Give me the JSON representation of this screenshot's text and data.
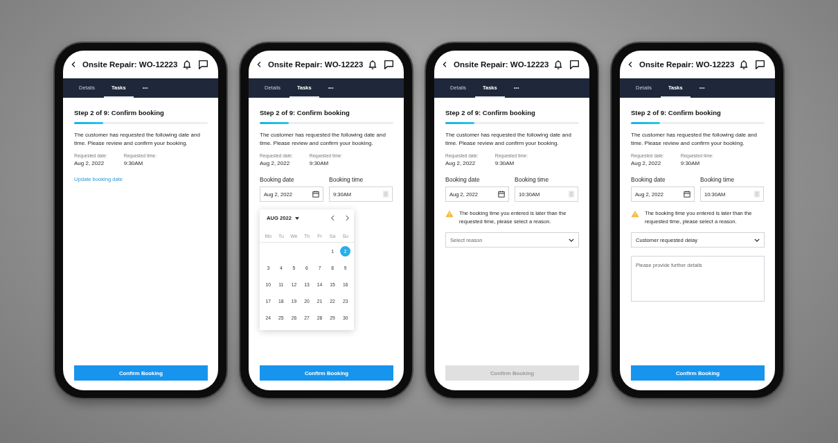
{
  "phones": [
    {
      "title": "Onsite Repair: WO-12223",
      "tabs": [
        {
          "label": "Details",
          "selected": false
        },
        {
          "label": "Tasks",
          "selected": true
        },
        {
          "label": "•••",
          "selected": false
        }
      ],
      "step": "Step 2 of 9: Confirm booking",
      "progress": {
        "level": 0.22
      },
      "description": "The customer has requested the following date and time. Please review and confirm your booking.",
      "requested": [
        {
          "label": "Requested date:",
          "value": "Aug 2, 2022"
        },
        {
          "label": "Requested time:",
          "value": "9:30AM"
        }
      ],
      "link": "Update booking date",
      "confirm": {
        "label": "Confirm Booking",
        "disabled": false
      }
    },
    {
      "title": "Onsite Repair: WO-12223",
      "tabs": [
        {
          "label": "Details",
          "selected": false
        },
        {
          "label": "Tasks",
          "selected": true
        },
        {
          "label": "•••",
          "selected": false
        }
      ],
      "step": "Step 2 of 9: Confirm booking",
      "progress": {
        "level": 0.22
      },
      "description": "The customer has requested the following date and time. Please review and confirm your booking.",
      "requested": [
        {
          "label": "Requested date:",
          "value": "Aug 2, 2022"
        },
        {
          "label": "Requested time:",
          "value": "9:30AM"
        }
      ],
      "booking": {
        "date_label": "Booking date",
        "date_value": "Aug 2, 2022",
        "time_label": "Booking time",
        "time_value": "9:30AM"
      },
      "calendar": {
        "month": "AUG 2022",
        "weekdays": [
          "Mo",
          "Tu",
          "We",
          "Th",
          "Fr",
          "Sa",
          "Su"
        ],
        "weeks": [
          [
            {
              "label": "1",
              "selected": false
            },
            {
              "label": "2",
              "selected": true
            }
          ],
          [
            {
              "label": "3",
              "selected": false
            },
            {
              "label": "4",
              "selected": false
            },
            {
              "label": "5",
              "selected": false
            },
            {
              "label": "6",
              "selected": false
            },
            {
              "label": "7",
              "selected": false
            },
            {
              "label": "8",
              "selected": false
            },
            {
              "label": "9",
              "selected": false
            }
          ],
          [
            {
              "label": "10",
              "selected": false
            },
            {
              "label": "11",
              "selected": false
            },
            {
              "label": "12",
              "selected": false
            },
            {
              "label": "13",
              "selected": false
            },
            {
              "label": "14",
              "selected": false
            },
            {
              "label": "15",
              "selected": false
            },
            {
              "label": "16",
              "selected": false
            }
          ],
          [
            {
              "label": "17",
              "selected": false
            },
            {
              "label": "18",
              "selected": false
            },
            {
              "label": "19",
              "selected": false
            },
            {
              "label": "20",
              "selected": false
            },
            {
              "label": "21",
              "selected": false
            },
            {
              "label": "22",
              "selected": false
            },
            {
              "label": "23",
              "selected": false
            }
          ],
          [
            {
              "label": "24",
              "selected": false
            },
            {
              "label": "25",
              "selected": false
            },
            {
              "label": "26",
              "selected": false
            },
            {
              "label": "27",
              "selected": false
            },
            {
              "label": "28",
              "selected": false
            },
            {
              "label": "29",
              "selected": false
            },
            {
              "label": "30",
              "selected": false
            }
          ]
        ]
      },
      "confirm": {
        "label": "Confirm Booking",
        "disabled": false
      }
    },
    {
      "title": "Onsite Repair: WO-12223",
      "tabs": [
        {
          "label": "Details",
          "selected": false
        },
        {
          "label": "Tasks",
          "selected": true
        },
        {
          "label": "•••",
          "selected": false
        }
      ],
      "step": "Step 2 of 9: Confirm booking",
      "progress": {
        "level": 0.22
      },
      "description": "The customer has requested the following date and time. Please review and confirm your booking.",
      "requested": [
        {
          "label": "Requested date:",
          "value": "Aug 2, 2022"
        },
        {
          "label": "Requested time:",
          "value": "9:30AM"
        }
      ],
      "booking": {
        "date_label": "Booking date",
        "date_value": "Aug 2, 2022",
        "time_label": "Booking time",
        "time_value": "10:30AM"
      },
      "warning": "The booking time you entered is later than the requested time, please select a reason.",
      "reason": {
        "placeholder": "Select reason"
      },
      "confirm": {
        "label": "Confirm Booking",
        "disabled": true
      }
    },
    {
      "title": "Onsite Repair: WO-12223",
      "tabs": [
        {
          "label": "Details",
          "selected": false
        },
        {
          "label": "Tasks",
          "selected": true
        },
        {
          "label": "•••",
          "selected": false
        }
      ],
      "step": "Step 2 of 9: Confirm booking",
      "progress": {
        "level": 0.22
      },
      "description": "The customer has requested the following date and time. Please review and confirm your booking.",
      "requested": [
        {
          "label": "Requested date:",
          "value": "Aug 2, 2022"
        },
        {
          "label": "Requested time:",
          "value": "9:30AM"
        }
      ],
      "booking": {
        "date_label": "Booking date",
        "date_value": "Aug 2, 2022",
        "time_label": "Booking time",
        "time_value": "10:30AM"
      },
      "warning": "The booking time you entered is later than the requested time, please select a reason.",
      "reason": {
        "value": "Customer requested delay"
      },
      "details": {
        "placeholder": "Please provide further details"
      },
      "confirm": {
        "label": "Confirm Booking",
        "disabled": false
      }
    }
  ]
}
